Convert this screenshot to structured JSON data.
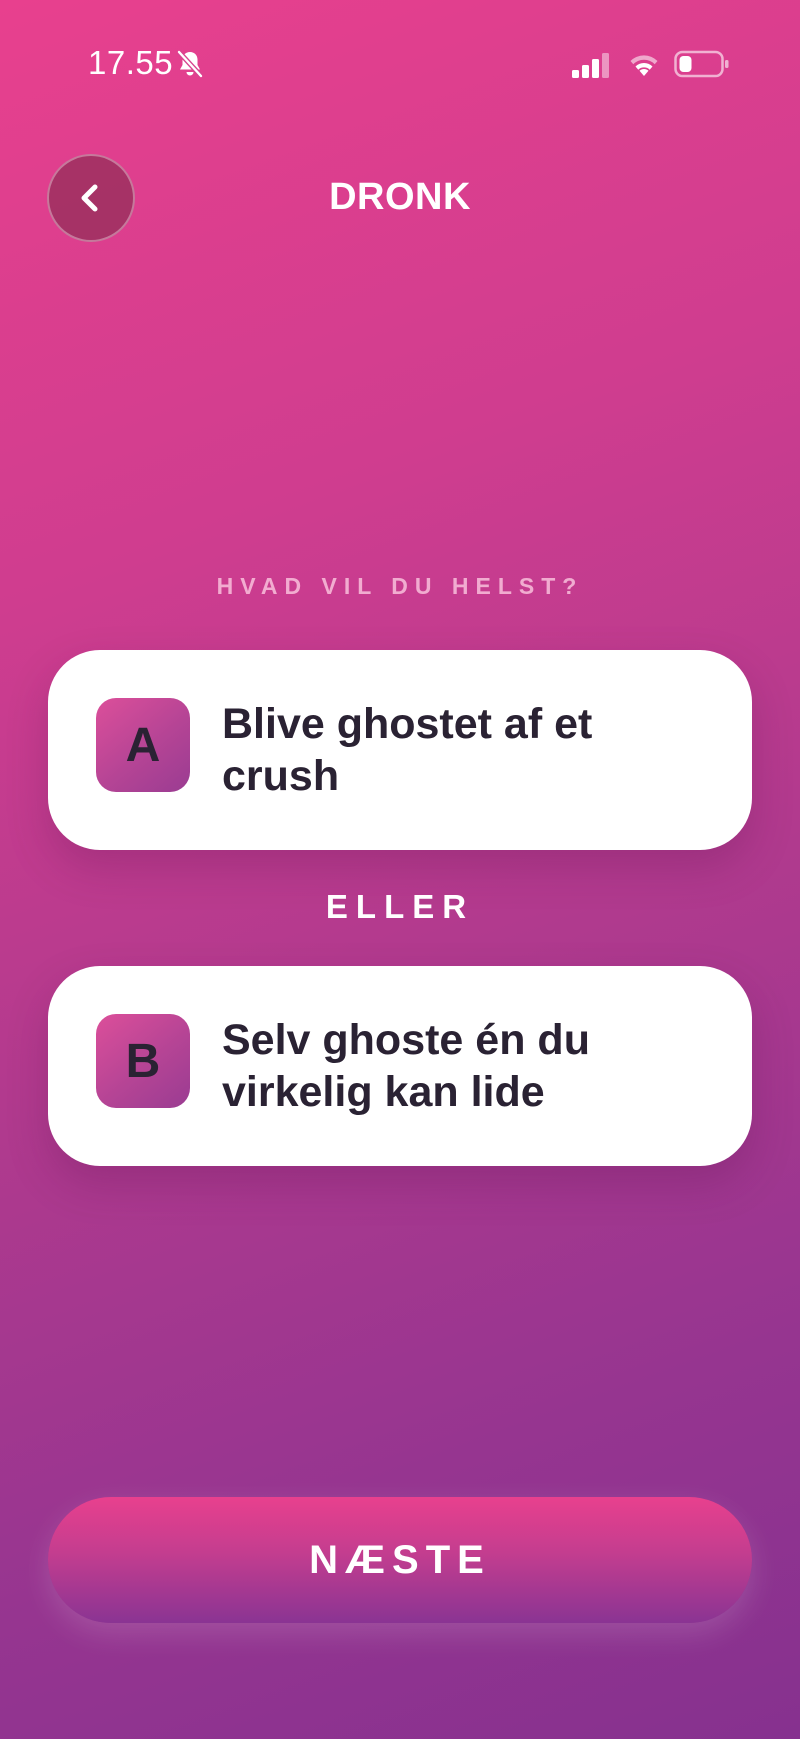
{
  "status_bar": {
    "time": "17.55",
    "icons": [
      "bell-off-icon",
      "signal-icon",
      "wifi-icon",
      "battery-icon"
    ]
  },
  "header": {
    "back_icon": "chevron-left-icon",
    "title": "DRONK"
  },
  "question": {
    "label": "HVAD VIL DU HELST?",
    "options": [
      {
        "letter": "A",
        "text": "Blive ghostet af et crush"
      },
      {
        "letter": "B",
        "text": "Selv ghoste én du virkelig kan lide"
      }
    ],
    "separator": "ELLER"
  },
  "footer": {
    "next_label": "NÆSTE"
  },
  "colors": {
    "gradient_top": "#e8408e",
    "gradient_bottom": "#86318f",
    "card_background": "#ffffff",
    "card_text": "#2a2233",
    "badge_gradient_start": "#dc4f9a",
    "badge_gradient_end": "#9a3c92"
  }
}
